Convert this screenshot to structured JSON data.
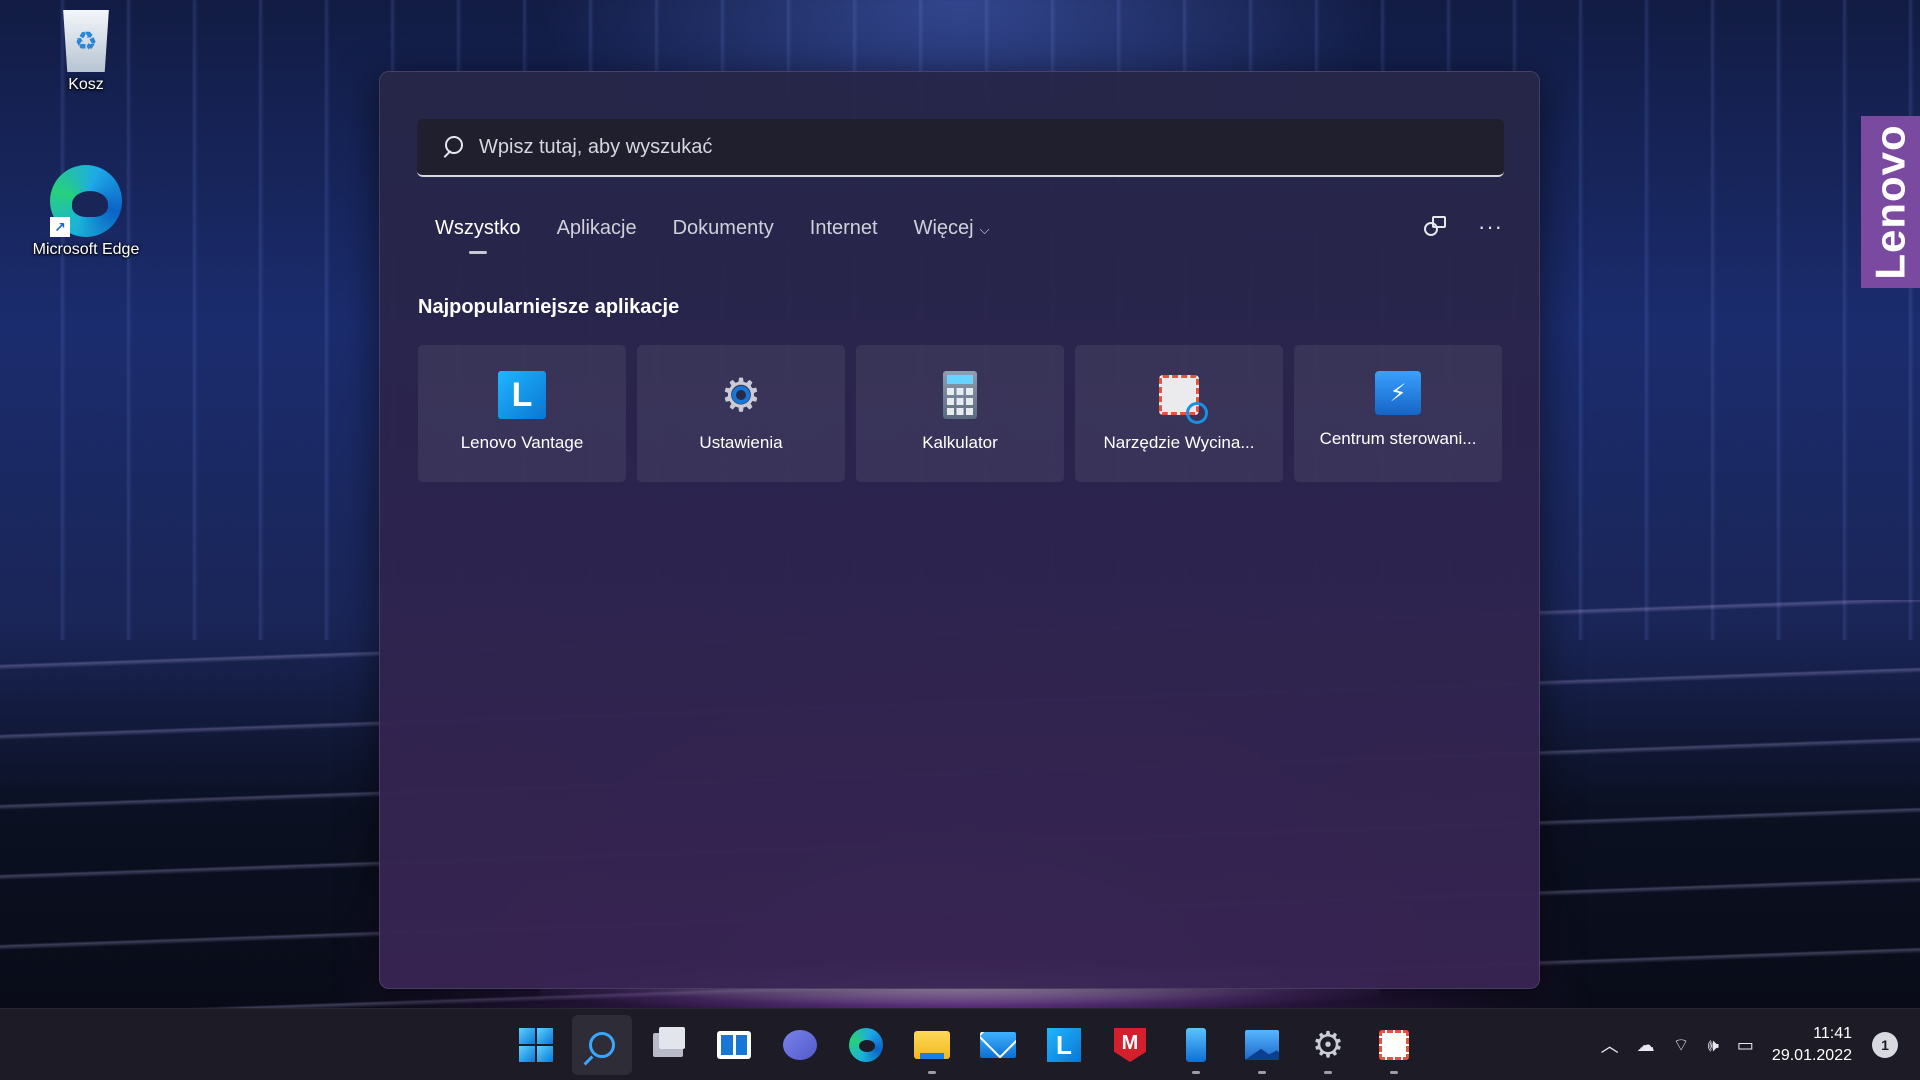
{
  "desktop": {
    "icons": [
      {
        "label": "Kosz",
        "icon": "recycle-bin-icon"
      },
      {
        "label": "Microsoft Edge",
        "icon": "edge-icon"
      }
    ],
    "brand_tab": "Lenovo"
  },
  "search": {
    "placeholder": "Wpisz tutaj, aby wyszukać",
    "value": "",
    "tabs": [
      {
        "label": "Wszystko",
        "active": true
      },
      {
        "label": "Aplikacje"
      },
      {
        "label": "Dokumenty"
      },
      {
        "label": "Internet"
      },
      {
        "label": "Więcej"
      }
    ],
    "section_title": "Najpopularniejsze aplikacje",
    "top_apps": [
      {
        "label": "Lenovo Vantage",
        "icon": "lenovo-vantage-icon"
      },
      {
        "label": "Ustawienia",
        "icon": "settings-gear-icon"
      },
      {
        "label": "Kalkulator",
        "icon": "calculator-icon"
      },
      {
        "label": "Narzędzie Wycina...",
        "icon": "snipping-tool-icon"
      },
      {
        "label": "Centrum sterowani...",
        "icon": "control-center-icon"
      }
    ]
  },
  "taskbar": {
    "apps": [
      "start-icon",
      "search-icon",
      "task-view-icon",
      "widgets-icon",
      "chat-icon",
      "edge-icon",
      "file-explorer-icon",
      "mail-icon",
      "lenovo-vantage-icon",
      "mcafee-icon",
      "phone-link-icon",
      "photos-icon",
      "settings-icon",
      "snipping-tool-icon"
    ],
    "time": "11:41",
    "date": "29.01.2022",
    "notification_count": "1"
  },
  "colors": {
    "accent": "#3aa7ff",
    "panel": "#2d2649",
    "taskbar": "#1c1b26"
  }
}
